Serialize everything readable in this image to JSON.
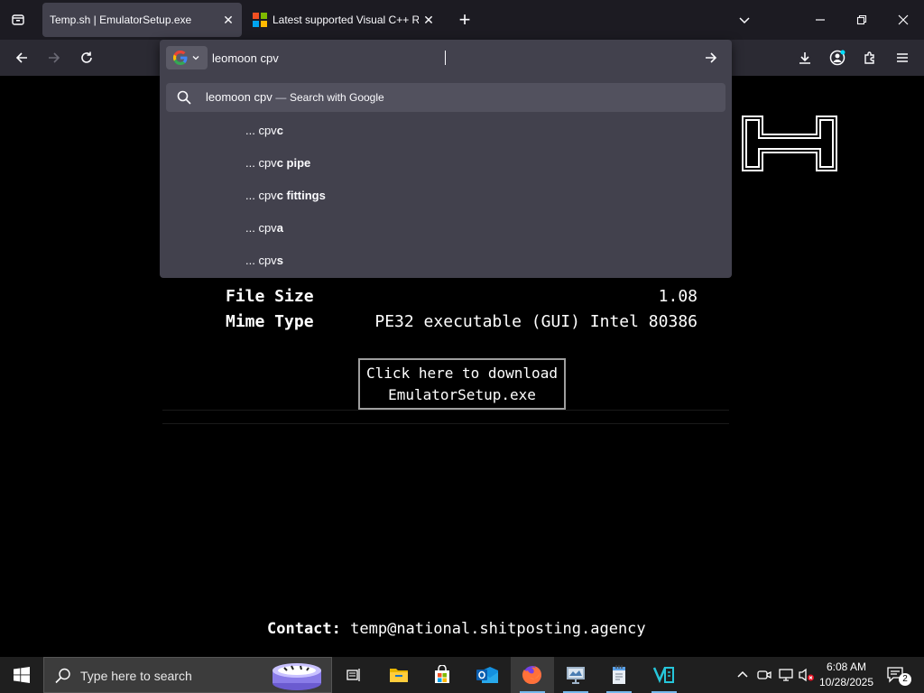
{
  "browser": {
    "tabs": [
      {
        "title": "Temp.sh | EmulatorSetup.exe",
        "active": true
      },
      {
        "title": "Latest supported Visual C++ Redistributable",
        "active": false
      }
    ],
    "new_tab_label": "+",
    "close_glyph": "✕"
  },
  "urlbar": {
    "value": "leomoon cpv",
    "search_engine_icon": "google-icon",
    "first_suggestion": {
      "query": "leomoon cpv",
      "separator": "—",
      "action": "Search with Google"
    },
    "suggestions": [
      {
        "prefix": "... cpv",
        "bold": "c"
      },
      {
        "prefix": "... cpv",
        "bold": "c pipe"
      },
      {
        "prefix": "... cpv",
        "bold": "c fittings"
      },
      {
        "prefix": "... cpv",
        "bold": "a"
      },
      {
        "prefix": "... cpv",
        "bold": "s"
      }
    ]
  },
  "page": {
    "rows": [
      {
        "label": "File Size",
        "value": "1.08"
      },
      {
        "label": "Mime Type",
        "value": "PE32 executable (GUI) Intel 80386"
      }
    ],
    "download_line1": "Click here to download",
    "download_line2": "EmulatorSetup.exe",
    "contact_label": "Contact:",
    "contact_email": "temp@national.shitposting.agency"
  },
  "taskbar": {
    "search_placeholder": "Type here to search",
    "time": "6:08 AM",
    "date": "10/28/2025",
    "notification_count": "2"
  },
  "colors": {
    "tabstrip": "#1c1b22",
    "toolbar": "#2b2a33",
    "panel": "#42414d",
    "page_bg": "#000000",
    "taskbar": "#1f1f1f"
  }
}
